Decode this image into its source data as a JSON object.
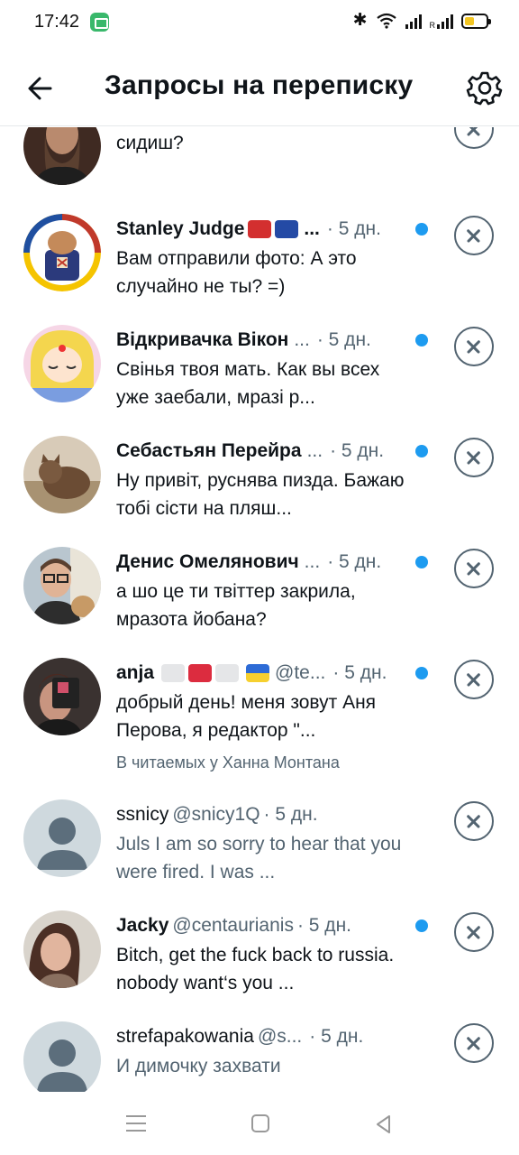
{
  "status_bar": {
    "time": "17:42",
    "bt_glyph": "✱",
    "signal_label": "R"
  },
  "header": {
    "title": "Запросы на переписку",
    "back_icon": "arrow-left-icon",
    "settings_icon": "gear-icon"
  },
  "colors": {
    "accent": "#1d9bf0",
    "text": "#0f1419",
    "muted": "#536471",
    "divider": "#e5e8eb"
  },
  "requests": [
    {
      "name": "",
      "handle": "",
      "time": "",
      "message": "сидиш?",
      "unread": false,
      "partial": true
    },
    {
      "name": "Stanley Judge",
      "handle": "",
      "time": "· 5 дн.",
      "message": "Вам отправили фото: А это случайно не ты? =)",
      "unread": true
    },
    {
      "name": "Відкривачка Вікон",
      "handle": "",
      "time": "· 5 дн.",
      "message": "Свiнья твоя мать. Как вы всех уже заебали, мразі р...",
      "unread": true
    },
    {
      "name": "Себастьян Перейра",
      "handle": "",
      "time": "· 5 дн.",
      "message": "Ну привіт, руснява пизда. Бажаю тобі сісти на пляш...",
      "unread": true
    },
    {
      "name": "Денис Омелянович",
      "handle": "",
      "time": "· 5 дн.",
      "message": "а шо це ти твіттер закрила, мразота йобана?",
      "unread": true
    },
    {
      "name": "anja",
      "handle": "@te...",
      "time": "· 5 дн.",
      "message": "добрый день! меня зовут Аня Перова, я редактор \"...",
      "context": "В читаемых у Ханна Монтана",
      "unread": true
    },
    {
      "name": "ssnicy",
      "handle": "@snicy1Q",
      "time": "· 5 дн.",
      "message": "Juls I am so sorry to hear that you were fired. I was ...",
      "unread": false
    },
    {
      "name": "Jacky",
      "handle": "@centaurianis",
      "time": "· 5 дн.",
      "message": "Bitch, get the fuck back to russia. nobody want‘s you ...",
      "unread": true
    },
    {
      "name": "strefapakowania",
      "handle": "@s...",
      "time": "· 5 дн.",
      "message": "И димочку захвати",
      "unread": false
    }
  ],
  "ellipsis": "..."
}
